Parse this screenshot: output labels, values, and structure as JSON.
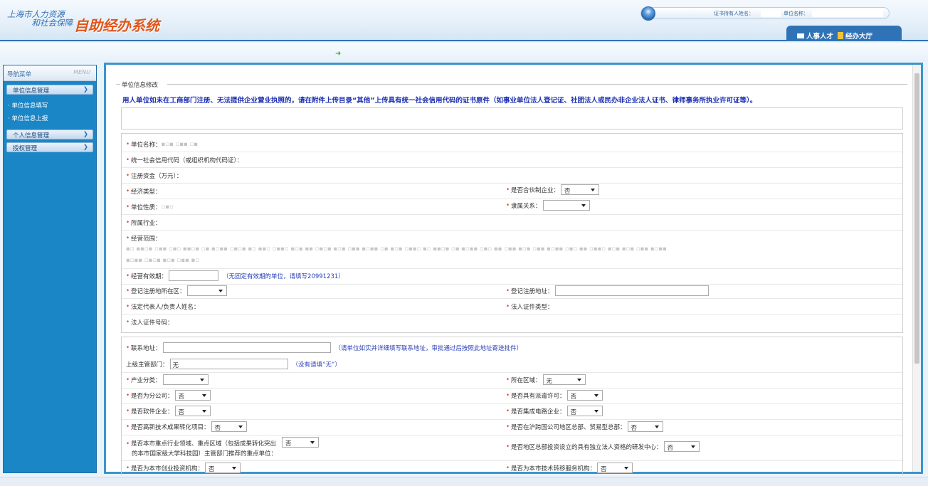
{
  "header": {
    "logo_line1": "上海市人力资源",
    "logo_line2": "和社会保障",
    "logo_title": "自助经办系统",
    "holder_label": "证书持有人姓名：",
    "unit_label": "单位名称：",
    "tabs": [
      "人事人才",
      "经办大厅"
    ]
  },
  "sidebar": {
    "title": "导航菜单",
    "title_en": "MENU",
    "items": [
      {
        "label": "单位信息管理",
        "sub": [
          "单位信息填写",
          "单位信息上报"
        ]
      },
      {
        "label": "个人信息管理"
      },
      {
        "label": "授权管理"
      }
    ]
  },
  "form": {
    "fieldset_title": "单位信息修改",
    "notice": "用人单位如未在工商部门注册、无法提供企业营业执照的，请在附件上传目录“其他”上传具有统一社会信用代码的证书原件（如事业单位法人登记证、社团法人或民办非企业法人证书、律师事务所执业许可证等）。",
    "section1": {
      "unit_name": "单位名称：",
      "credit_code": "统一社会信用代码（或组织机构代码证）：",
      "reg_capital": "注册资金（万元）：",
      "econ_type": "经济类型：",
      "partnership": "是否合伙制企业：",
      "partnership_val": "否",
      "unit_nature": "单位性质：",
      "affiliation": "隶属关系：",
      "industry": "所属行业：",
      "biz_scope": "经营范围：",
      "validity": "经营有效期：",
      "validity_hint": "（无固定有效期的单位，请填写20991231）",
      "reg_district": "登记注册地所在区：",
      "reg_address": "登记注册地址：",
      "legal_rep": "法定代表人/负责人姓名：",
      "legal_id_type": "法人证件类型：",
      "legal_id_no": "法人证件号码："
    },
    "section2": {
      "contact_addr": "联系地址：",
      "contact_hint": "（请单位如实并详细填写联系地址，审批通过后按照此地址寄送批件）",
      "superior": "上级主管部门：",
      "superior_val": "无",
      "superior_hint": "（没有请填“无”）",
      "industry_cat": "产业分类：",
      "region": "所在区域：",
      "region_val": "无",
      "branch": "是否为分公司：",
      "branch_val": "否",
      "dispatch": "是否具有派遣许可：",
      "dispatch_val": "否",
      "software": "是否软件企业：",
      "software_val": "否",
      "ic": "是否集成电路企业：",
      "ic_val": "否",
      "hightech": "是否高新技术成果转化项目：",
      "hightech_val": "否",
      "hq": "是否在沪跨国公司地区总部、贸易型总部：",
      "hq_val": "否",
      "key_line1": "是否本市重点行业领域、重点区域（包括成果转化突出",
      "key_line2": "的本市国家级大学科技园）主管部门推荐的重点单位：",
      "key_val": "否",
      "rnd": "是否地区总部投资设立的具有独立法人资格的研发中心：",
      "rnd_val": "否",
      "venture": "是否为本市创业投资机构：",
      "venture_val": "否",
      "tech_transfer": "是否为本市技术转移服务机构：",
      "tech_transfer_val": "否"
    }
  }
}
